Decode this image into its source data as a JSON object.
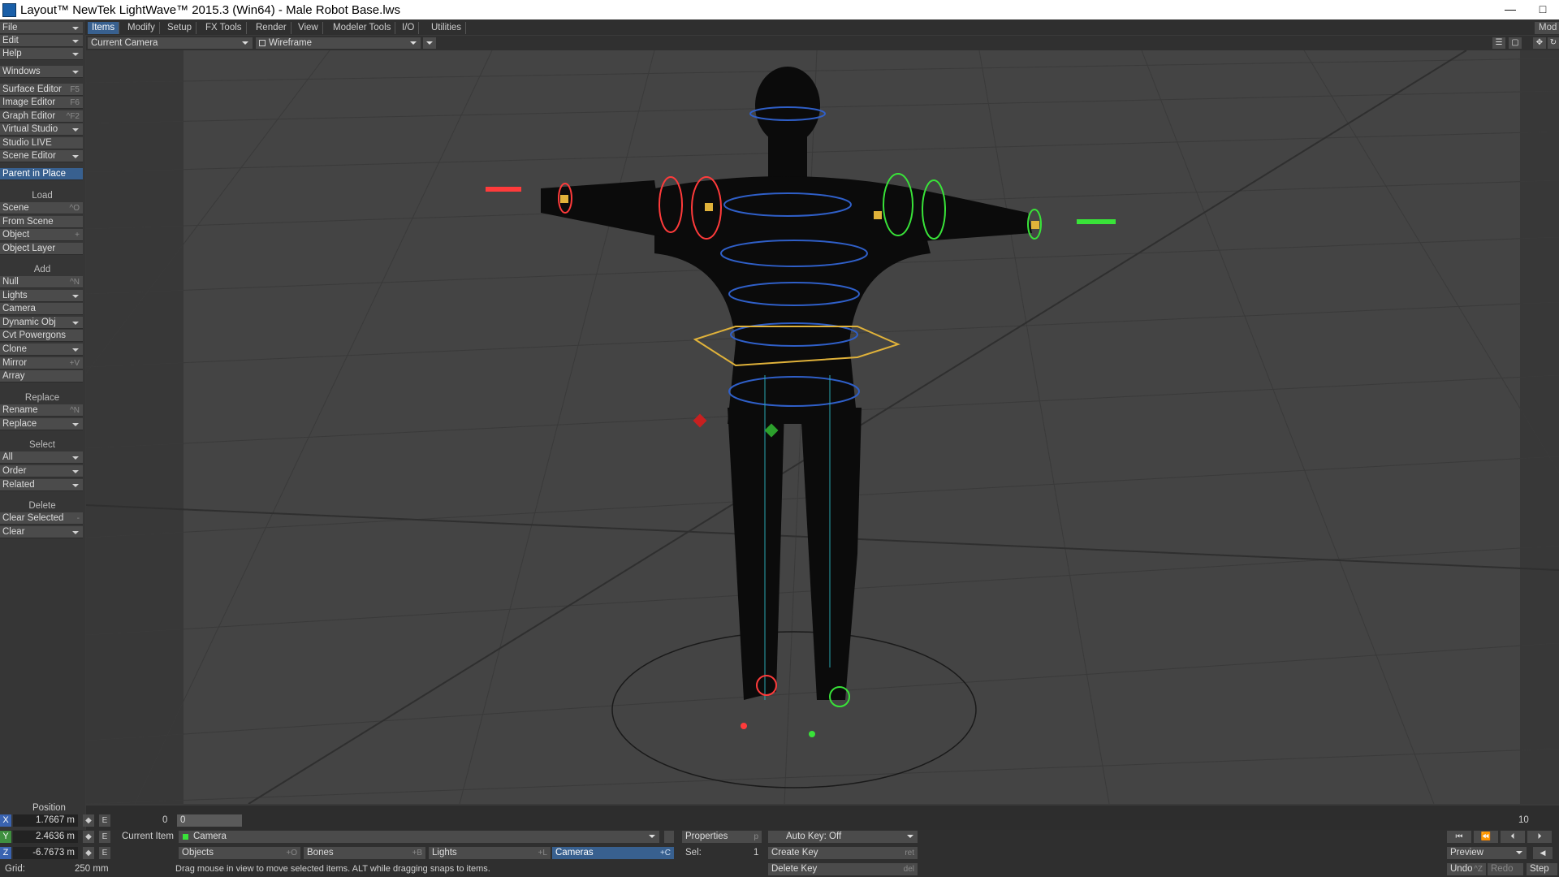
{
  "window": {
    "title": "Layout™ NewTek LightWave™ 2015.3 (Win64) - Male Robot Base.lws",
    "min": "—",
    "max": "□"
  },
  "menu_tabs": [
    "Items",
    "Modify",
    "Setup",
    "FX Tools",
    "Render",
    "View",
    "Modeler Tools",
    "I/O",
    "Utilities"
  ],
  "modeler_btn": "Mod",
  "left": {
    "file": "File",
    "edit": "Edit",
    "help": "Help",
    "windows": "Windows",
    "surface_editor": "Surface Editor",
    "surface_editor_sc": "F5",
    "image_editor": "Image Editor",
    "image_editor_sc": "F6",
    "graph_editor": "Graph Editor",
    "graph_editor_sc": "^F2",
    "virtual_studio": "Virtual Studio",
    "studio_live": "Studio LIVE",
    "scene_editor": "Scene Editor",
    "parent_in_place": "Parent in Place",
    "load_head": "Load",
    "scene": "Scene",
    "scene_sc": "^O",
    "from_scene": "From Scene",
    "object": "Object",
    "object_sc": "+",
    "object_layer": "Object Layer",
    "add_head": "Add",
    "null": "Null",
    "null_sc": "^N",
    "lights": "Lights",
    "camera": "Camera",
    "dynamic_obj": "Dynamic Obj",
    "cvt_powergons": "Cvt Powergons",
    "clone": "Clone",
    "mirror": "Mirror",
    "mirror_sc": "+V",
    "array": "Array",
    "replace_head": "Replace",
    "rename": "Rename",
    "rename_sc": "^N",
    "replace": "Replace",
    "select_head": "Select",
    "all": "All",
    "order": "Order",
    "related": "Related",
    "delete_head": "Delete",
    "clear_selected": "Clear Selected",
    "clear_selected_sc": "-",
    "clear": "Clear"
  },
  "viewport": {
    "camera": "Current Camera",
    "mode": "Wireframe"
  },
  "timeline": {
    "start": "0",
    "end": "10"
  },
  "position": {
    "label": "Position",
    "x_axis": "X",
    "y_axis": "Y",
    "z_axis": "Z",
    "x": "1.7667 m",
    "y": "2.4636 m",
    "z": "-6.7673 m",
    "e": "E",
    "frame": "0",
    "frame_slider": "0",
    "grid_label": "Grid:",
    "grid": "250 mm"
  },
  "current_item": {
    "label": "Current Item",
    "value": "Camera"
  },
  "filters": {
    "objects": "Objects",
    "objects_sc": "+O",
    "bones": "Bones",
    "bones_sc": "+B",
    "lights": "Lights",
    "lights_sc": "+L",
    "cameras": "Cameras",
    "cameras_sc": "+C"
  },
  "properties": {
    "label": "Properties",
    "sc": "p",
    "sel_label": "Sel:",
    "sel": "1"
  },
  "keys": {
    "auto_key": "Auto Key: Off",
    "create_key": "Create Key",
    "create_key_sc": "ret",
    "delete_key": "Delete Key",
    "delete_key_sc": "del"
  },
  "playback": {
    "preview": "Preview",
    "undo": "Undo",
    "undo_sc": "^Z",
    "redo": "Redo",
    "step": "Step"
  },
  "status": "Drag mouse in view to move selected items. ALT while dragging snaps to items.",
  "colors": {
    "accent": "#38608f",
    "rig_left": "#ff3b3b",
    "rig_right": "#39e339",
    "spine": "#2f5fc8",
    "hip": "#e0b23a"
  }
}
